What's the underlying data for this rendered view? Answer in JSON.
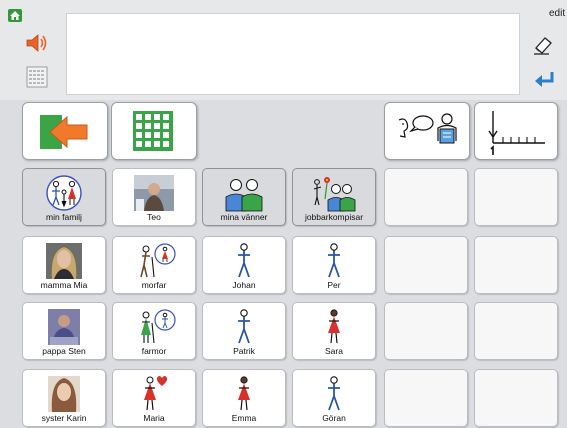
{
  "toolbar": {
    "edit_label": "edit"
  },
  "message": {
    "text": ""
  },
  "grid": {
    "row1": [
      "min familj",
      "Teo",
      "mina vänner",
      "jobbarkompisar",
      "",
      ""
    ],
    "row2": [
      "mamma Mia",
      "morfar",
      "Johan",
      "Per",
      "",
      ""
    ],
    "row3": [
      "pappa Sten",
      "farmor",
      "Patrik",
      "Sara",
      "",
      ""
    ],
    "row4": [
      "syster Karin",
      "Maria",
      "Emma",
      "Göran",
      "",
      ""
    ]
  },
  "colors": {
    "home": "#2f9a35",
    "back_arrow": "#f07a2a",
    "grid_icon": "#3aa548",
    "enter_arrow": "#2b7fd0",
    "man_figure": "#2a55a5",
    "woman_figure": "#d8302a"
  },
  "icons": {
    "home": "home-icon",
    "speaker": "speaker-icon",
    "keyboard": "keyboard-icon",
    "eraser": "eraser-icon",
    "enter": "enter-icon",
    "back": "back-arrow-icon",
    "grid": "grid-icon",
    "talk": "talk-icon",
    "number_line": "number-line-icon"
  }
}
